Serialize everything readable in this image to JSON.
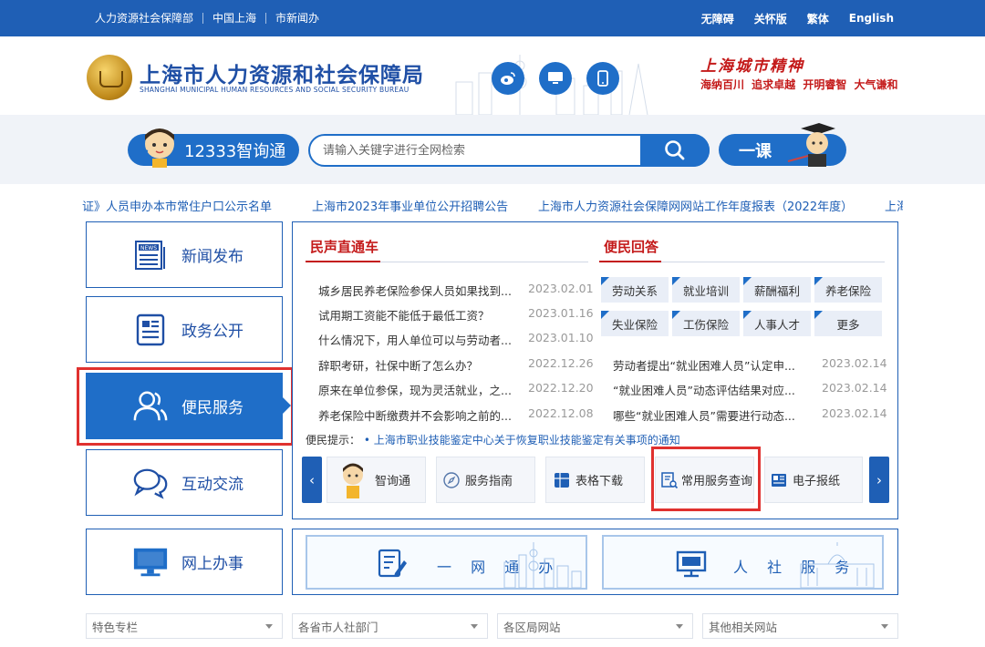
{
  "topbar": {
    "left_links": [
      "人力资源社会保障部",
      "中国上海",
      "市新闻办"
    ],
    "right_links": [
      "无障碍",
      "关怀版",
      "繁体",
      "English"
    ]
  },
  "header": {
    "title_cn": "上海市人力资源和社会保障局",
    "title_en": "SHANGHAI MUNICIPAL HUMAN RESOURCES AND SOCIAL SECURITY BUREAU",
    "social_icons": [
      "weibo-icon",
      "monitor-icon",
      "mobile-icon"
    ],
    "spirit_title": "上海城市精神",
    "spirit_text": "海纳百川 追求卓越 开明睿智 大气谦和"
  },
  "search": {
    "hotline_label": "12333智询通",
    "placeholder": "请输入关键字进行全网检索",
    "yike_label": "一课"
  },
  "ticker": [
    "证》人员申办本市常住户口公示名单",
    "上海市2023年事业单位公开招聘公告",
    "上海市人力资源社会保障网网站工作年度报表（2022年度）",
    "上海"
  ],
  "nav": [
    {
      "label": "新闻发布",
      "icon": "news-icon"
    },
    {
      "label": "政务公开",
      "icon": "document-icon"
    },
    {
      "label": "便民服务",
      "icon": "users-icon"
    },
    {
      "label": "互动交流",
      "icon": "chat-icon"
    },
    {
      "label": "网上办事",
      "icon": "computer-icon"
    }
  ],
  "section_left": {
    "title": "民声直通车",
    "items": [
      {
        "title": "城乡居民养老保险参保人员如果找到...",
        "date": "2023.02.01"
      },
      {
        "title": "试用期工资能不能低于最低工资？",
        "date": "2023.01.16"
      },
      {
        "title": "什么情况下，用人单位可以与劳动者...",
        "date": "2023.01.10"
      },
      {
        "title": "辞职考研，社保中断了怎么办？",
        "date": "2022.12.26"
      },
      {
        "title": "原来在单位参保，现为灵活就业，之...",
        "date": "2022.12.20"
      },
      {
        "title": "养老保险中断缴费并不会影响之前的...",
        "date": "2022.12.08"
      }
    ]
  },
  "section_right": {
    "title": "便民回答",
    "tags": [
      "劳动关系",
      "就业培训",
      "薪酬福利",
      "养老保险",
      "失业保险",
      "工伤保险",
      "人事人才",
      "更多"
    ],
    "items": [
      {
        "title": "劳动者提出“就业困难人员”认定申...",
        "date": "2023.02.14"
      },
      {
        "title": "“就业困难人员”动态评估结果对应...",
        "date": "2023.02.14"
      },
      {
        "title": "哪些“就业困难人员”需要进行动态...",
        "date": "2023.02.14"
      }
    ]
  },
  "tip": {
    "label": "便民提示：",
    "text": "• 上海市职业技能鉴定中心关于恢复职业技能鉴定有关事项的通知"
  },
  "services": [
    "智询通",
    "服务指南",
    "表格下载",
    "常用服务查询",
    "电子报纸"
  ],
  "banners": [
    "一 网 通 办",
    "人 社 服 务"
  ],
  "dropdowns": [
    "特色专栏",
    "各省市人社部门",
    "各区局网站",
    "其他相关网站"
  ],
  "colors": {
    "primary": "#1f5fb5",
    "accent_red": "#c41a1a",
    "highlight": "#e0312f"
  }
}
